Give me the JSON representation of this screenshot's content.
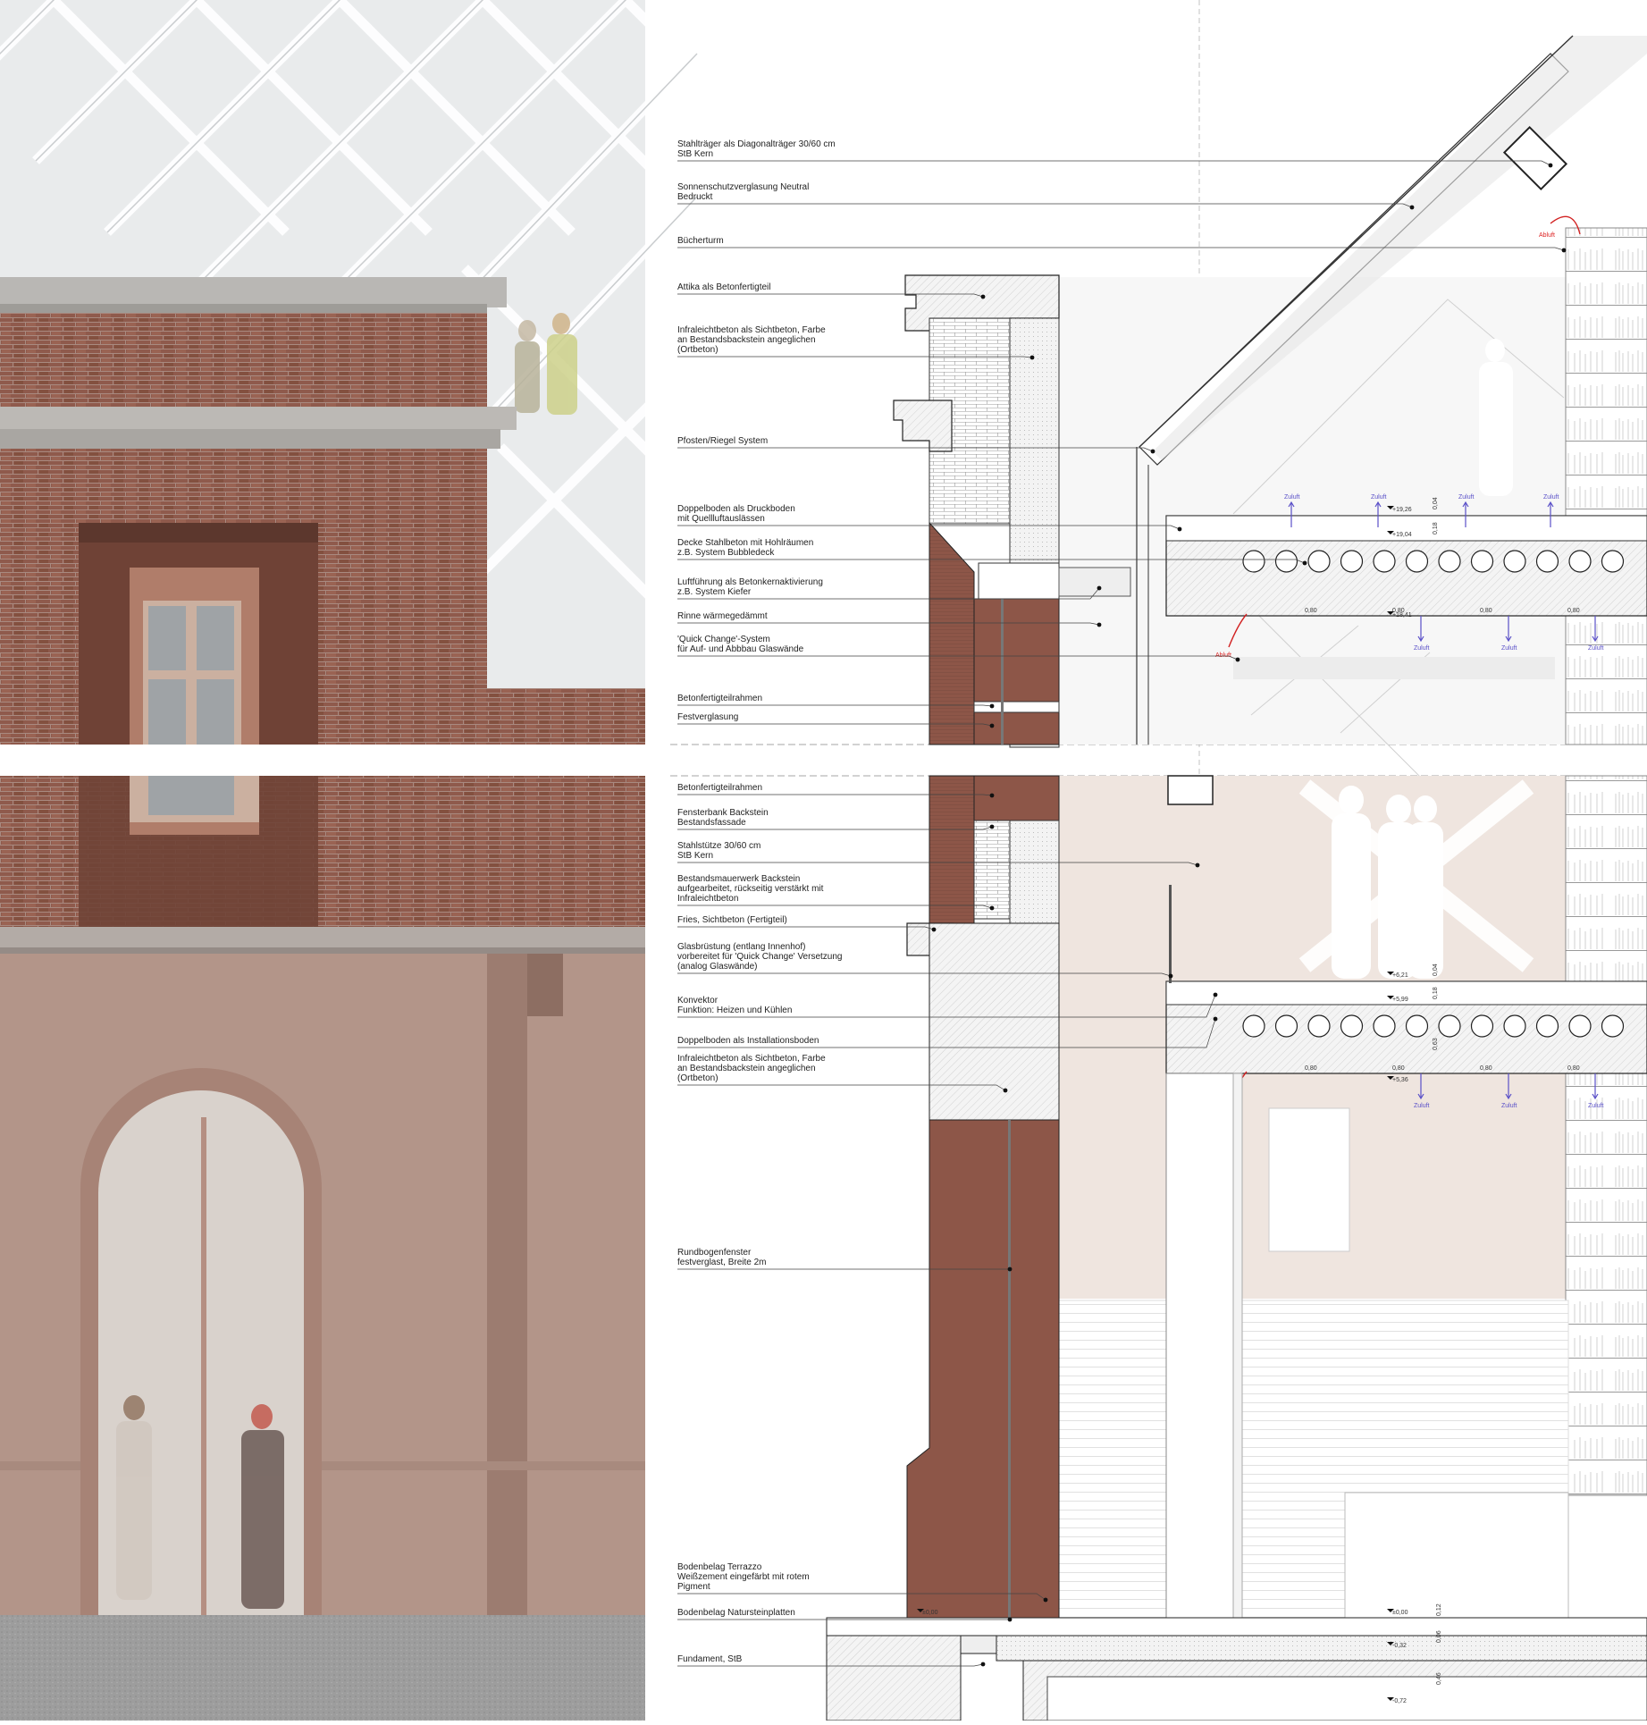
{
  "labels_upper": [
    [
      "Stahlträger als Diagonalträger 30/60 cm",
      "StB Kern"
    ],
    [
      "Sonnenschutzverglasung Neutral",
      "Bedruckt"
    ],
    [
      "Bücherturm"
    ],
    [
      "Attika als Betonfertigteil"
    ],
    [
      "Infraleichtbeton als Sichtbeton, Farbe",
      "an Bestandsbackstein angeglichen",
      "(Ortbeton)"
    ],
    [
      "Pfosten/Riegel System"
    ],
    [
      "Doppelboden als Druckboden",
      "mit Quellluftauslässen"
    ],
    [
      "Decke Stahlbeton mit Hohlräumen",
      "z.B. System Bubbledeck"
    ],
    [
      "Luftführung als Betonkernaktivierung",
      "z.B. System Kiefer"
    ],
    [
      "Rinne wärmegedämmt"
    ],
    [
      "'Quick Change'-System",
      "für Auf- und Abbbau Glaswände"
    ],
    [
      "Betonfertigteilrahmen"
    ],
    [
      "Festverglasung"
    ]
  ],
  "labels_lower": [
    [
      "Betonfertigteilrahmen"
    ],
    [
      "Fensterbank Backstein",
      "Bestandsfassade"
    ],
    [
      "Stahlstütze 30/60 cm",
      "StB Kern"
    ],
    [
      "Bestandsmauerwerk Backstein",
      "aufgearbeitet, rückseitig verstärkt mit",
      "Infraleichtbeton"
    ],
    [
      "Fries, Sichtbeton (Fertigteil)"
    ],
    [
      "Glasbrüstung (entlang Innenhof)",
      "vorbereitet für 'Quick Change' Versetzung",
      "(analog Glaswände)"
    ],
    [
      "Konvektor",
      "Funktion: Heizen und Kühlen"
    ],
    [
      "Doppelboden als Installationsboden"
    ],
    [
      "Infraleichtbeton als Sichtbeton, Farbe",
      "an Bestandsbackstein angeglichen",
      "(Ortbeton)"
    ],
    [
      "Rundbogenfenster",
      "festverglast, Breite 2m"
    ],
    [
      "Bodenbelag Terrazzo",
      "Weißzement eingefärbt mit rotem",
      "Pigment"
    ],
    [
      "Bodenbelag Natursteinplatten"
    ],
    [
      "Fundament, StB"
    ]
  ],
  "flow": {
    "zuluft": "Zuluft",
    "abluft": "Abluft"
  },
  "levels_upper": {
    "floor_top": "+19,26",
    "floor_mid": "+19,04",
    "ceiling": "+18,41"
  },
  "levels_lower": {
    "floor_top": "+6,21",
    "floor_mid": "+5,99",
    "ceiling": "+5,36"
  },
  "levels_ground": {
    "floor": "±0,00",
    "slab": "-0,32",
    "foundation": "-0,72",
    "outside": "±0,00"
  },
  "dims": {
    "spacing": "0,80",
    "slab_upper": [
      "0,04",
      "0,18"
    ],
    "slab_lower": [
      "0,04",
      "0,18",
      "0,63"
    ],
    "ground": [
      "0,12",
      "0,06",
      "0,46"
    ]
  },
  "colors": {
    "brick": "#8f5a4c",
    "plaster": "#b39589",
    "concrete": "#c4c1bd",
    "sky": "#e6e8ea",
    "section_brick": "#8d5648",
    "interior_pink": "#efe5df",
    "zuluft_arrow": "#5a50c8",
    "abluft_arrow": "#d22222"
  }
}
